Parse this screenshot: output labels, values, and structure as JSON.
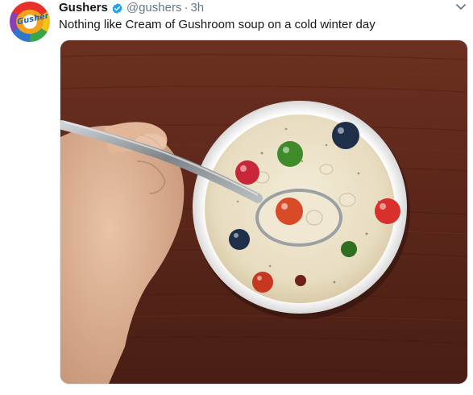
{
  "tweet": {
    "display_name": "Gushers",
    "handle": "@gushers",
    "separator": "·",
    "time": "3h",
    "text": "Nothing like Cream of Gushroom soup on a cold winter day",
    "avatar_logo_text": "Gushers",
    "verified_icon": "verified-badge-icon",
    "menu_icon": "chevron-down-icon",
    "verified_color": "#1da1f2"
  }
}
